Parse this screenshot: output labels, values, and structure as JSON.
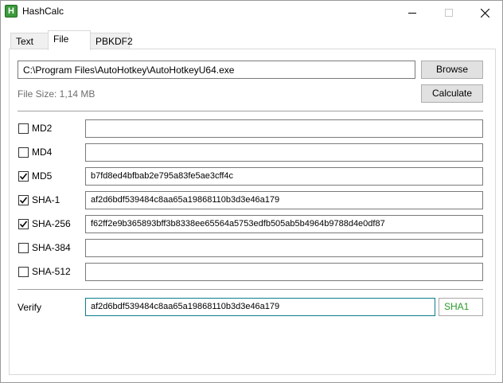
{
  "window": {
    "title": "HashCalc"
  },
  "tabs": [
    {
      "label": "Text",
      "active": false
    },
    {
      "label": "File",
      "active": true
    },
    {
      "label": "PBKDF2",
      "active": false
    }
  ],
  "file": {
    "path": "C:\\Program Files\\AutoHotkey\\AutoHotkeyU64.exe",
    "size_text": "File Size: 1,14 MB",
    "browse_label": "Browse",
    "calculate_label": "Calculate"
  },
  "hashes": [
    {
      "label": "MD2",
      "checked": false,
      "value": ""
    },
    {
      "label": "MD4",
      "checked": false,
      "value": ""
    },
    {
      "label": "MD5",
      "checked": true,
      "value": "b7fd8ed4bfbab2e795a83fe5ae3cff4c"
    },
    {
      "label": "SHA-1",
      "checked": true,
      "value": "af2d6bdf539484c8aa65a19868110b3d3e46a179"
    },
    {
      "label": "SHA-256",
      "checked": true,
      "value": "f62ff2e9b365893bff3b8338ee65564a5753edfb505ab5b4964b9788d4e0df87"
    },
    {
      "label": "SHA-384",
      "checked": false,
      "value": ""
    },
    {
      "label": "SHA-512",
      "checked": false,
      "value": ""
    }
  ],
  "verify": {
    "label": "Verify",
    "value": "af2d6bdf539484c8aa65a19868110b3d3e46a179",
    "match": "SHA1",
    "match_color": "#2a9a2a"
  },
  "icons": {
    "app": "hashcalc-app-icon",
    "minimize": "minimize-icon",
    "maximize": "maximize-icon",
    "close": "close-icon",
    "check": "checkmark-icon"
  },
  "colors": {
    "focus_border": "#0a7e8c",
    "match_text": "#2a9a2a"
  }
}
